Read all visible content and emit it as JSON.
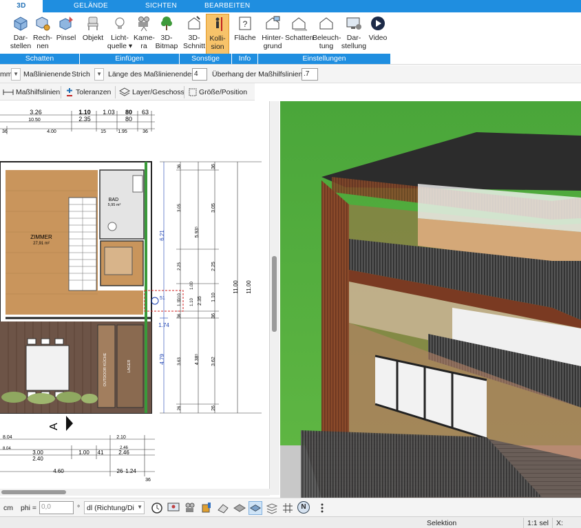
{
  "ribbon_tabs": [
    "3D",
    "GELÄNDE",
    "SICHTEN",
    "BEARBEITEN"
  ],
  "ribbon": {
    "buttons": [
      {
        "l1": "Dar-",
        "l2": "stellen"
      },
      {
        "l1": "Rech-",
        "l2": "nen"
      },
      {
        "l1": "Pinsel",
        "l2": ""
      },
      {
        "l1": "Objekt",
        "l2": ""
      },
      {
        "l1": "Licht-",
        "l2": "quelle ▾"
      },
      {
        "l1": "Kame-",
        "l2": "ra"
      },
      {
        "l1": "3D-",
        "l2": "Bitmap"
      },
      {
        "l1": "3D-",
        "l2": "Schnitt"
      },
      {
        "l1": "Kolli-",
        "l2": "sion"
      },
      {
        "l1": "Fläche",
        "l2": ""
      },
      {
        "l1": "Hinter-",
        "l2": "grund"
      },
      {
        "l1": "Schatten",
        "l2": ""
      },
      {
        "l1": "Beleuch-",
        "l2": "tung"
      },
      {
        "l1": "Dar-",
        "l2": "stellung"
      },
      {
        "l1": "Video",
        "l2": ""
      }
    ],
    "groups": [
      "Schatten",
      "Einfügen",
      "Sonstige",
      "Info",
      "Einstellungen"
    ]
  },
  "propbar": {
    "unit_fragment": "mm",
    "end_label": "Maßlinienende",
    "end_value": "Strich",
    "length_label": "Länge des Maßlinienendes",
    "length_value": "4",
    "overhang_label": "Überhang der Maßhilfslinien",
    "overhang_value": ".7"
  },
  "toolbar": {
    "aux_lines": "Maßhilfslinien",
    "tolerances": "Toleranzen",
    "layer": "Layer/Geschoss",
    "size_position": "Größe/Position"
  },
  "plan": {
    "rooms": [
      {
        "name": "ZIMMER",
        "area": "27,91 m²"
      },
      {
        "name": "BAD",
        "area": "5,95 m²"
      },
      {
        "name": "OUTDOOR KÜCHE",
        "area": ""
      },
      {
        "name": "LAGER",
        "area": ""
      }
    ],
    "dims_top": [
      "3.26",
      "1.10",
      "1.03",
      "80",
      "63",
      "10.50",
      "2.35",
      "80",
      "36",
      "4.00",
      "15",
      "1.95",
      "36"
    ],
    "dims_bottom": [
      "8.04",
      "2.10",
      "8.04",
      "2.46",
      "3.00",
      "1.00",
      "41",
      "2.46",
      "2.40",
      "4.60",
      "26",
      "1.24",
      "36"
    ],
    "dims_right": [
      "36",
      "3.05",
      "2.25",
      "1.10",
      "36",
      "3.63",
      "26",
      "6.21",
      "1.74",
      "4.79",
      "5.93⁵",
      "2.35",
      "4.38⁵",
      "11.00",
      "36",
      "3.05",
      "2.25",
      "1.10",
      "36",
      "3.62",
      "26",
      "11.00"
    ],
    "small": [
      "51",
      "1.10",
      "1.00",
      "1.10"
    ],
    "section_marker": "A"
  },
  "bottombar": {
    "unit": "cm",
    "phi_label": "phi =",
    "phi_value": "0,0",
    "degree": "°",
    "direction": "dl (Richtung/Di",
    "north": "N"
  },
  "status": {
    "mode": "Selektion",
    "scale": "1:1 sel",
    "coord_label": "X:"
  },
  "colors": {
    "ribbon_blue": "#1f8ee0",
    "active_button": "#f7c36a",
    "floor_wood": "#c9955c",
    "facade_wood": "#8a4a2a",
    "grass": "#5bb43a"
  }
}
